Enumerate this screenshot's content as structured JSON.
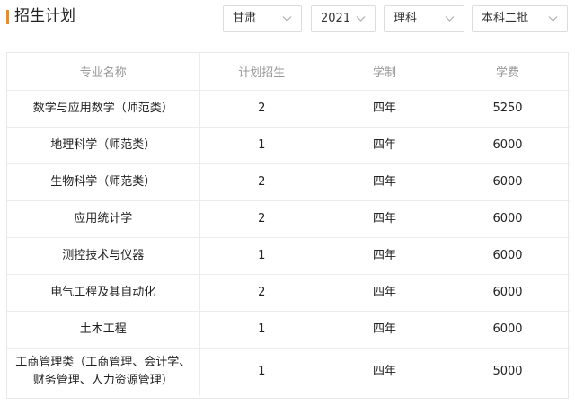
{
  "page": {
    "title": "招生计划",
    "accent_color": "#f08a1c"
  },
  "filters": {
    "province": "甘肃",
    "year": "2021",
    "subject": "理科",
    "batch": "本科二批",
    "dropdown_icon": "chevron-down-icon"
  },
  "table": {
    "headers": [
      "专业名称",
      "计划招生",
      "学制",
      "学费"
    ],
    "rows": [
      {
        "major": "数学与应用数学（师范类）",
        "plan": "2",
        "duration": "四年",
        "fee": "5250"
      },
      {
        "major": "地理科学（师范类）",
        "plan": "1",
        "duration": "四年",
        "fee": "6000"
      },
      {
        "major": "生物科学（师范类）",
        "plan": "2",
        "duration": "四年",
        "fee": "6000"
      },
      {
        "major": "应用统计学",
        "plan": "2",
        "duration": "四年",
        "fee": "6000"
      },
      {
        "major": "测控技术与仪器",
        "plan": "1",
        "duration": "四年",
        "fee": "6000"
      },
      {
        "major": "电气工程及其自动化",
        "plan": "2",
        "duration": "四年",
        "fee": "6000"
      },
      {
        "major": "土木工程",
        "plan": "1",
        "duration": "四年",
        "fee": "6000"
      },
      {
        "major": "工商管理类（工商管理、会计学、财务管理、人力资源管理）",
        "plan": "1",
        "duration": "四年",
        "fee": "5000"
      }
    ]
  }
}
